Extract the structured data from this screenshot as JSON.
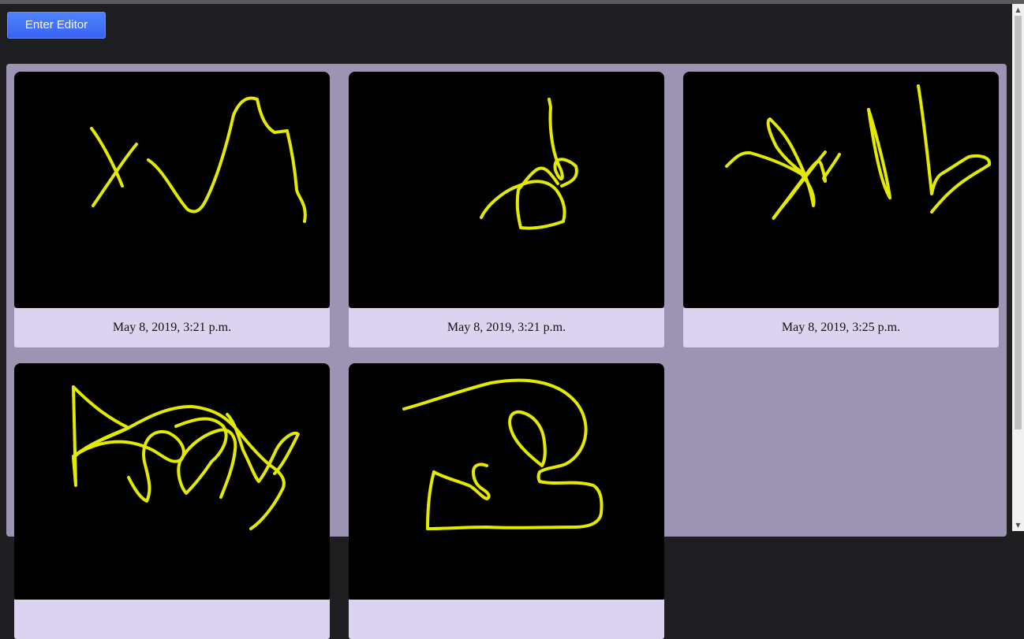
{
  "toolbar": {
    "enter_editor_label": "Enter Editor"
  },
  "drawings": [
    {
      "timestamp": "May 8, 2019, 3:21 p.m."
    },
    {
      "timestamp": "May 8, 2019, 3:21 p.m."
    },
    {
      "timestamp": "May 8, 2019, 3:25 p.m."
    },
    {
      "timestamp": ""
    },
    {
      "timestamp": ""
    }
  ],
  "colors": {
    "stroke": "#e3ea00",
    "canvas": "#000000",
    "gallery_bg": "#9d94b4",
    "caption_bg": "#dcd3f0",
    "button": "#3f6ef8"
  },
  "scrollbar": {
    "up_icon": "triangle-up",
    "down_icon": "triangle-down"
  }
}
